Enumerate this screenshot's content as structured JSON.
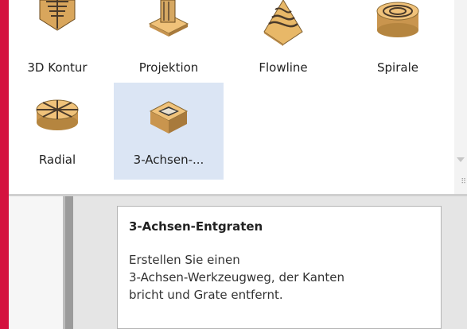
{
  "tools": [
    {
      "label": "3D Kontur",
      "icon": "3d-contour-icon"
    },
    {
      "label": "Projektion",
      "icon": "projection-icon"
    },
    {
      "label": "Flowline",
      "icon": "flowline-icon"
    },
    {
      "label": "Spirale",
      "icon": "spiral-icon"
    },
    {
      "label": "Radial",
      "icon": "radial-icon"
    },
    {
      "label": "3-Achsen-...",
      "icon": "3-axis-deburr-icon",
      "selected": true
    }
  ],
  "tooltip": {
    "title": "3-Achsen-Entgraten",
    "lines": [
      "Erstellen Sie einen",
      "3-Achsen-Werkzeugweg, der Kanten",
      "bricht und Grate entfernt."
    ]
  },
  "colors": {
    "frame": "#d4123f",
    "selection": "#dbe5f4",
    "icon_wood": "#e0b56e"
  }
}
